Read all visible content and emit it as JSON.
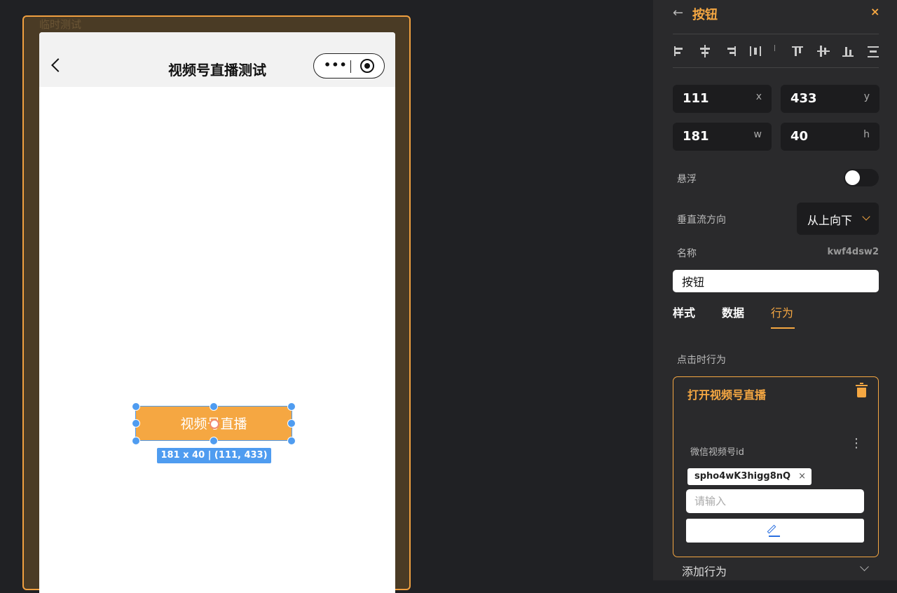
{
  "canvas": {
    "frame_title": "临时测试",
    "phone": {
      "nav_title": "视频号直播测试",
      "capsule_more": "•••"
    },
    "selected_button": {
      "label": "视频号直播",
      "size_info": "181 x 40 | (111, 433)"
    }
  },
  "panel": {
    "back_icon": "←",
    "title": "按钮",
    "close_icon": "×",
    "fields": {
      "x": {
        "value": "111",
        "unit": "x"
      },
      "y": {
        "value": "433",
        "unit": "y"
      },
      "w": {
        "value": "181",
        "unit": "w"
      },
      "h": {
        "value": "40",
        "unit": "h"
      }
    },
    "float_label": "悬浮",
    "float_enabled": false,
    "flow_label": "垂直流方向",
    "flow_value": "从上向下",
    "name_label": "名称",
    "name_id": "kwf4dsw2",
    "name_value": "按钮",
    "tabs": [
      {
        "label": "样式",
        "active": false
      },
      {
        "label": "数据",
        "active": false
      },
      {
        "label": "行为",
        "active": true
      }
    ],
    "click_behavior_label": "点击时行为",
    "action": {
      "title": "打开视频号直播",
      "field_label": "微信视频号id",
      "kebab": "⋮",
      "tag": "spho4wK3higg8nQ",
      "tag_remove": "×",
      "input_placeholder": "请输入"
    },
    "add_action_label": "添加行为"
  },
  "colors": {
    "accent": "#f5a742",
    "selection": "#4f9cf0",
    "panel_bg": "#2a2a2c",
    "canvas_bg": "#202124"
  }
}
